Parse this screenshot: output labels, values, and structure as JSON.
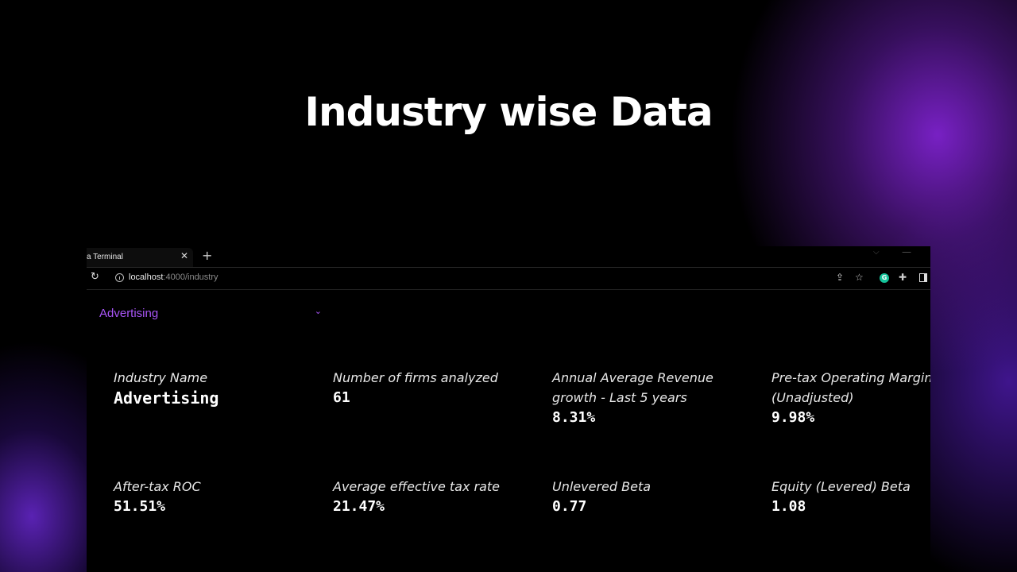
{
  "slide": {
    "title": "Industry wise Data"
  },
  "browser": {
    "tab_title": "a Terminal",
    "url_host": "localhost",
    "url_rest": ":4000/industry"
  },
  "page": {
    "industry_select": {
      "value": "Advertising"
    },
    "stats": [
      {
        "label": "Industry Name",
        "value": "Advertising"
      },
      {
        "label": "Number of firms analyzed",
        "value": "61"
      },
      {
        "label": "Annual Average Revenue growth - Last 5 years",
        "value": "8.31%"
      },
      {
        "label": "Pre-tax Operating Margin (Unadjusted)",
        "value": "9.98%"
      },
      {
        "label": "After-tax ROC",
        "value": "51.51%"
      },
      {
        "label": "Average effective tax rate",
        "value": "21.47%"
      },
      {
        "label": "Unlevered Beta",
        "value": "0.77"
      },
      {
        "label": "Equity (Levered) Beta",
        "value": "1.08"
      }
    ]
  },
  "icons": {
    "tab_close": "close-icon",
    "new_tab": "plus-icon",
    "reload": "reload-icon",
    "site_info": "info-icon",
    "share": "share-icon",
    "bookmark": "star-icon",
    "grammarly": "grammarly-icon",
    "extensions": "puzzle-icon",
    "side_panel": "side-panel-icon",
    "dropdown": "chevron-down-icon"
  },
  "colors": {
    "accent": "#a855f7",
    "background": "#000000",
    "glow": "#7e22ce"
  }
}
